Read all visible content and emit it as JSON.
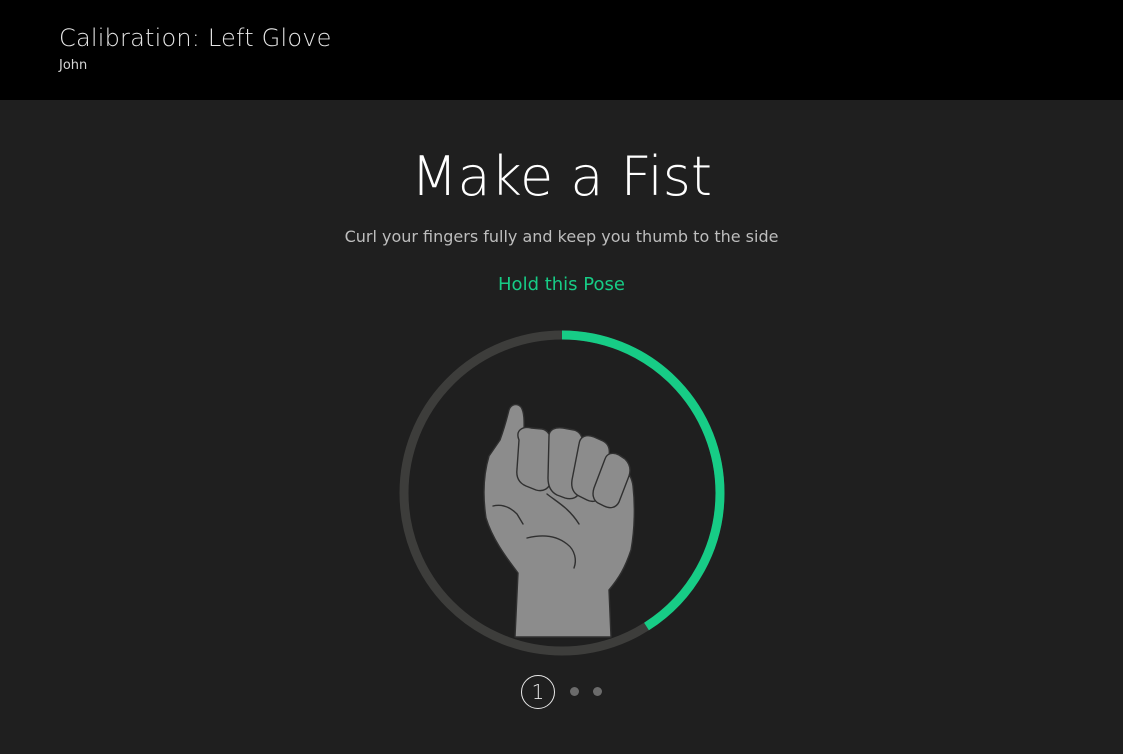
{
  "header": {
    "title": "Calibration: Left Glove",
    "user": "John"
  },
  "pose": {
    "title": "Make a Fist",
    "instructions": "Curl your fingers fully and keep you thumb to the side",
    "status": "Hold this Pose",
    "icon": "fist-icon",
    "hold_progress": 0.41
  },
  "pager": {
    "current_page": "1",
    "total_steps": 3
  },
  "colors": {
    "header_bg": "#000000",
    "body_bg": "#1f1f1f",
    "accent": "#17cc86",
    "track": "#3d3d3b",
    "hand_fill": "#8c8c8c"
  }
}
